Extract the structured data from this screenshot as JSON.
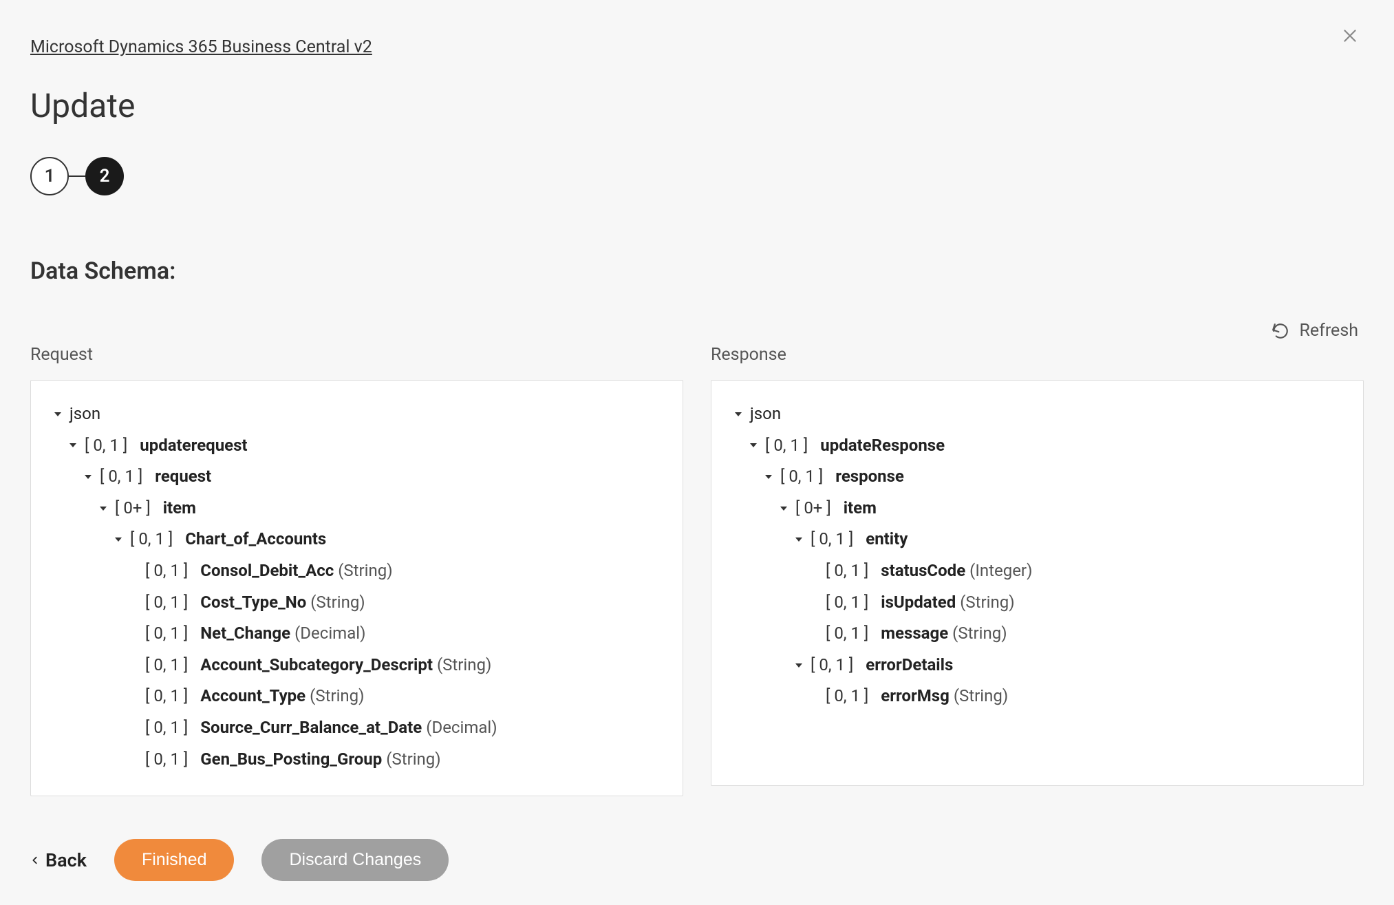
{
  "breadcrumb": "Microsoft Dynamics 365 Business Central v2",
  "page_title": "Update",
  "stepper": {
    "step1": "1",
    "step2": "2"
  },
  "section_title": "Data Schema:",
  "refresh_label": "Refresh",
  "request_label": "Request",
  "response_label": "Response",
  "back_label": "Back",
  "finished_label": "Finished",
  "discard_label": "Discard Changes",
  "request_tree": {
    "root": "json",
    "l1_card": "[ 0, 1 ]",
    "l1_name": "updaterequest",
    "l2_card": "[ 0, 1 ]",
    "l2_name": "request",
    "l3_card": "[ 0+ ]",
    "l3_name": "item",
    "l4_card": "[ 0, 1 ]",
    "l4_name": "Chart_of_Accounts",
    "fields": [
      {
        "card": "[ 0, 1 ]",
        "name": "Consol_Debit_Acc",
        "type": "(String)"
      },
      {
        "card": "[ 0, 1 ]",
        "name": "Cost_Type_No",
        "type": "(String)"
      },
      {
        "card": "[ 0, 1 ]",
        "name": "Net_Change",
        "type": "(Decimal)"
      },
      {
        "card": "[ 0, 1 ]",
        "name": "Account_Subcategory_Descript",
        "type": "(String)"
      },
      {
        "card": "[ 0, 1 ]",
        "name": "Account_Type",
        "type": "(String)"
      },
      {
        "card": "[ 0, 1 ]",
        "name": "Source_Curr_Balance_at_Date",
        "type": "(Decimal)"
      },
      {
        "card": "[ 0, 1 ]",
        "name": "Gen_Bus_Posting_Group",
        "type": "(String)"
      }
    ]
  },
  "response_tree": {
    "root": "json",
    "l1_card": "[ 0, 1 ]",
    "l1_name": "updateResponse",
    "l2_card": "[ 0, 1 ]",
    "l2_name": "response",
    "l3_card": "[ 0+ ]",
    "l3_name": "item",
    "l4_card": "[ 0, 1 ]",
    "l4_name": "entity",
    "entity_fields": [
      {
        "card": "[ 0, 1 ]",
        "name": "statusCode",
        "type": "(Integer)"
      },
      {
        "card": "[ 0, 1 ]",
        "name": "isUpdated",
        "type": "(String)"
      },
      {
        "card": "[ 0, 1 ]",
        "name": "message",
        "type": "(String)"
      }
    ],
    "err_card": "[ 0, 1 ]",
    "err_name": "errorDetails",
    "err_fields": [
      {
        "card": "[ 0, 1 ]",
        "name": "errorMsg",
        "type": "(String)"
      }
    ]
  }
}
